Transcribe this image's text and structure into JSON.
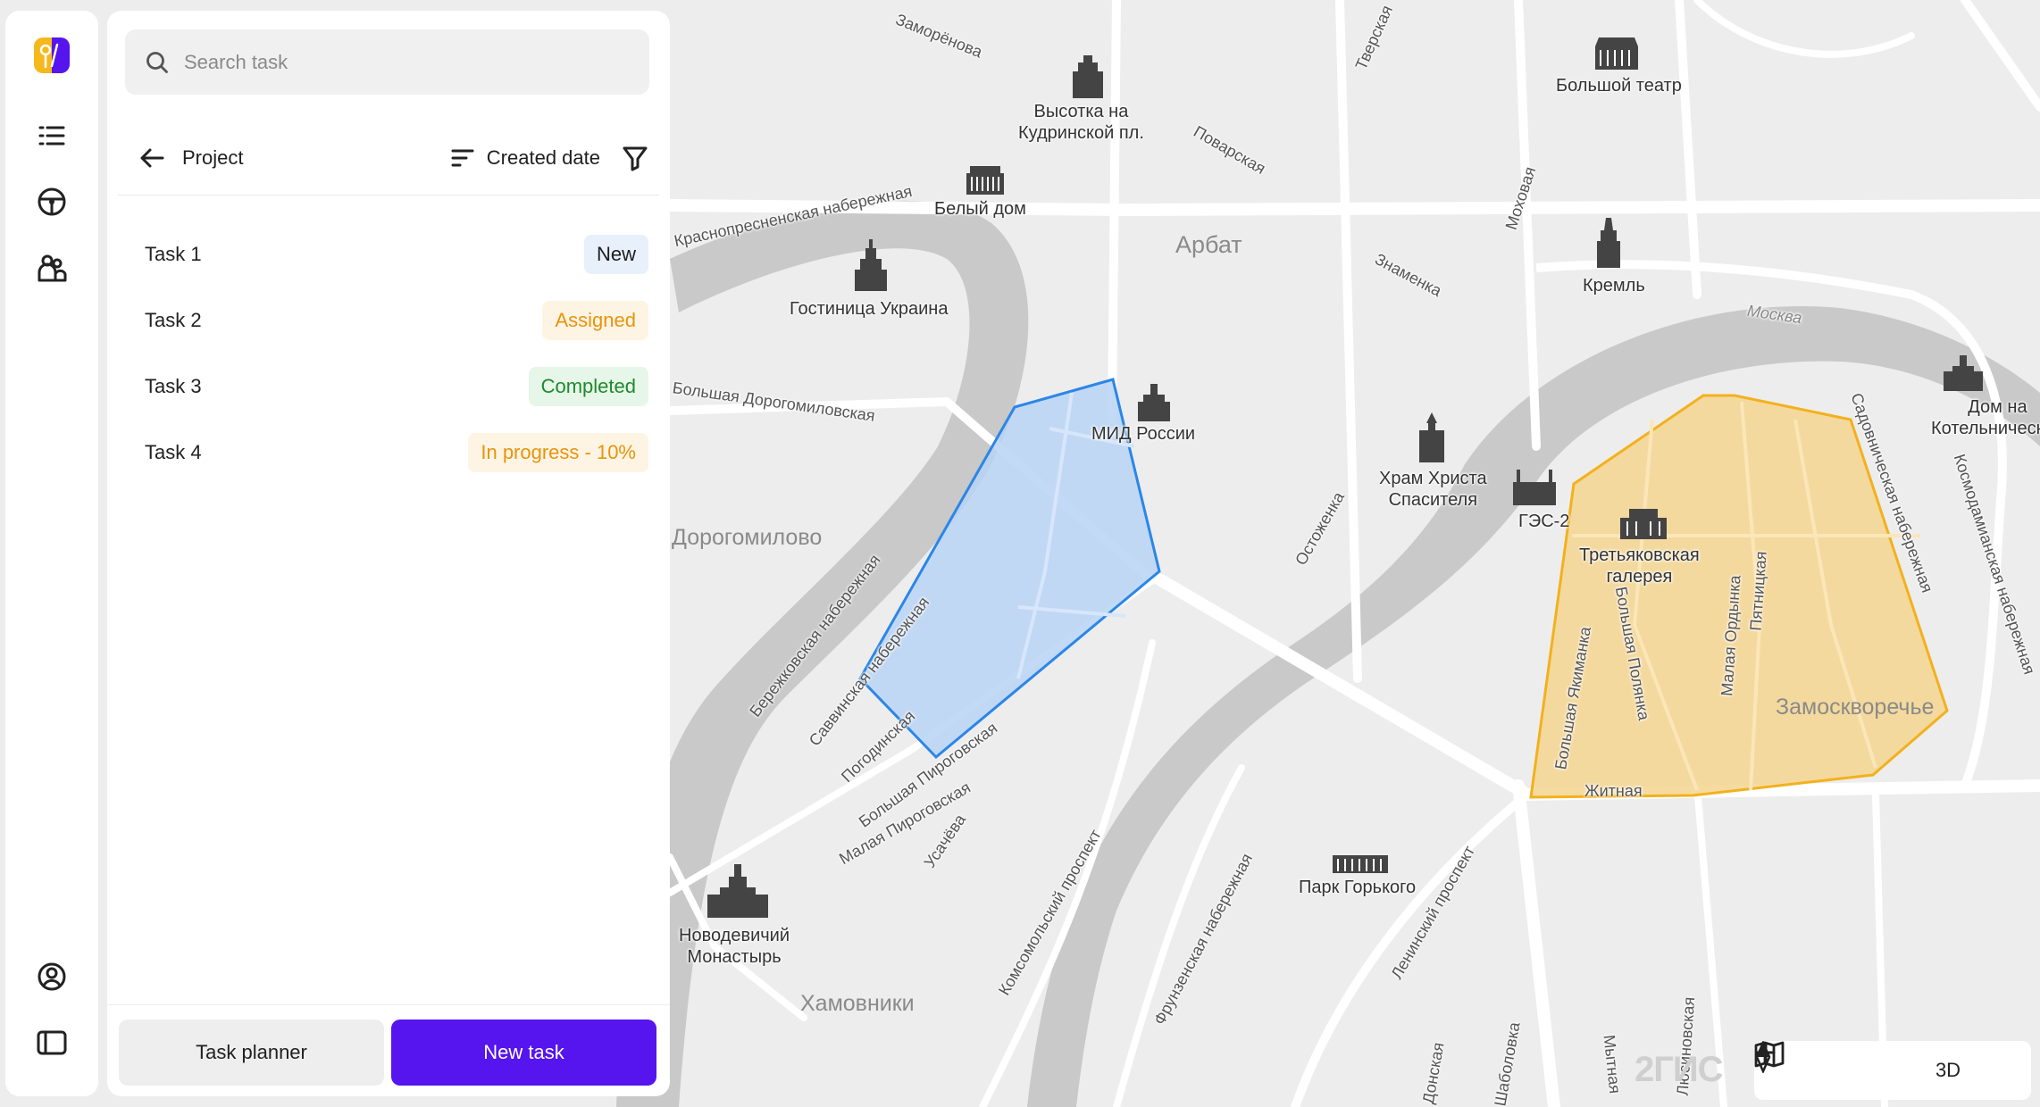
{
  "search": {
    "placeholder": "Search task"
  },
  "toolbar": {
    "back_label": "Project",
    "sort_label": "Created date"
  },
  "tasks": [
    {
      "name": "Task 1",
      "status": "New"
    },
    {
      "name": "Task 2",
      "status": "Assigned"
    },
    {
      "name": "Task 3",
      "status": "Completed"
    },
    {
      "name": "Task 4",
      "status": "In progress - 10%"
    }
  ],
  "footer": {
    "planner_label": "Task planner",
    "new_label": "New task"
  },
  "map": {
    "labels": {
      "zamorenova": "Заморёнова",
      "vysotka": "Высотка на\nКудринской пл.",
      "bolshoi": "Большой театр",
      "povarskaya": "Поварская",
      "krasnopresnenskaya": "Краснопресненская набережная",
      "bely_dom": "Белый дом",
      "arbat": "Арбат",
      "mokhovaya": "Моховая",
      "znamenka": "Знаменка",
      "kreml": "Кремль",
      "moskva_river": "Москва",
      "ukraina": "Гостиница Украина",
      "dorogomilovskaya": "Большая Дорогомиловская",
      "mid": "МИД России",
      "hram": "Храм Христа\nСпасителя",
      "ges": "ГЭС-2",
      "tretyakovka": "Третьяковская\nгалерея",
      "dom_kotel": "Дом на\nКотельнической",
      "dorogomilovo": "Дорогомилово",
      "ostozhenka": "Остоженка",
      "berezhkovskaya": "Бережковская набережная",
      "savvinskaya": "Саввинская набережная",
      "pogodinskaya": "Погодинская",
      "b_pirogovskaya": "Большая Пироговская",
      "m_pirogovskaya": "Малая Пироговская",
      "usacheva": "Усачёва",
      "komsomolsky": "Комсомольский проспект",
      "frunzenskaya": "Фрунзенская набережная",
      "leninsky": "Ленинский проспект",
      "park_gorkogo": "Парк Горького",
      "novodevichy": "Новодевичий\nМонастырь",
      "khamovniki": "Хамовники",
      "zamoskvorechye": "Замоскворечье",
      "b_polyanka": "Большая Полянка",
      "m_ordynka": "Малая Ордынка",
      "pyatnitskaya": "Пятницкая",
      "yakimanka": "Большая Якиманка",
      "zhitnaya": "Житная",
      "sadovnicheskaya": "Садовническая набережная",
      "kosmodamianskaya": "Космодамианская набережная",
      "tverskaya": "Тверская",
      "shabolovka": "Шаболовка",
      "mytnaya": "Мытная",
      "donskaya": "Донская",
      "lyusinovskaya": "Люсиновская"
    },
    "zones": [
      {
        "name": "blue-zone",
        "fill": "#b9d3f5",
        "stroke": "#2b86e8"
      },
      {
        "name": "yellow-zone",
        "fill": "#f5d58f",
        "stroke": "#f2b11d"
      }
    ],
    "logo": "2ГИС",
    "controls": {
      "threed_label": "3D"
    }
  },
  "colors": {
    "accent": "#5614ee",
    "assigned": "#e8940c",
    "completed": "#1f8a2c"
  }
}
